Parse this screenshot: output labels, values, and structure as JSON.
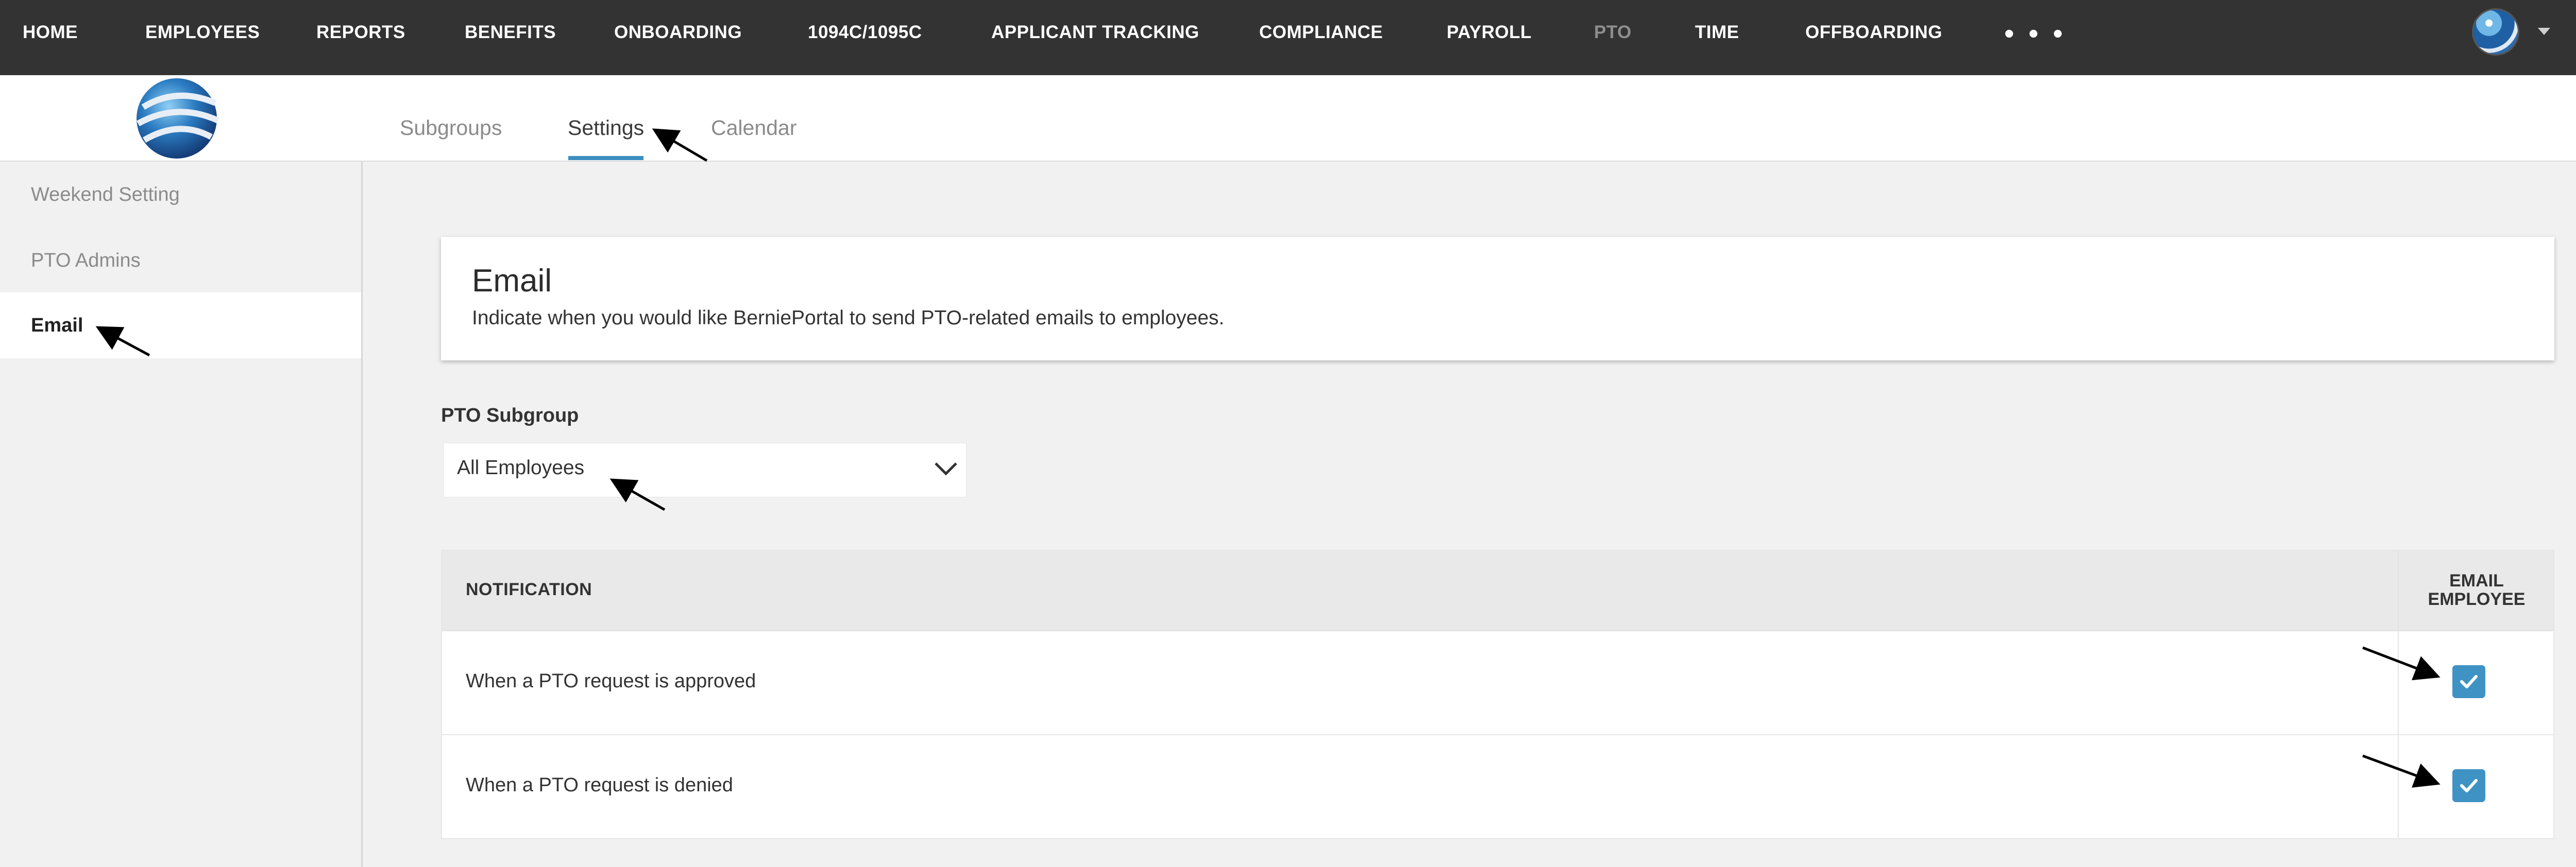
{
  "topnav": {
    "items": [
      {
        "label": "HOME",
        "active": false
      },
      {
        "label": "EMPLOYEES",
        "active": false
      },
      {
        "label": "REPORTS",
        "active": false
      },
      {
        "label": "BENEFITS",
        "active": false
      },
      {
        "label": "ONBOARDING",
        "active": false
      },
      {
        "label": "1094C/1095C",
        "active": false
      },
      {
        "label": "APPLICANT TRACKING",
        "active": false
      },
      {
        "label": "COMPLIANCE",
        "active": false
      },
      {
        "label": "PAYROLL",
        "active": false
      },
      {
        "label": "PTO",
        "active": true
      },
      {
        "label": "TIME",
        "active": false
      },
      {
        "label": "OFFBOARDING",
        "active": false
      }
    ],
    "more_label": "• • •"
  },
  "tabs": [
    {
      "label": "Subgroups",
      "active": false
    },
    {
      "label": "Settings",
      "active": true
    },
    {
      "label": "Calendar",
      "active": false
    }
  ],
  "sidebar": {
    "items": [
      {
        "label": "Weekend Setting",
        "active": false
      },
      {
        "label": "PTO Admins",
        "active": false
      },
      {
        "label": "Email",
        "active": true
      }
    ]
  },
  "card": {
    "title": "Email",
    "description": "Indicate when you would like BerniePortal to send PTO-related emails to employees."
  },
  "subgroup": {
    "label": "PTO Subgroup",
    "selected": "All Employees"
  },
  "table": {
    "columns": [
      "NOTIFICATION",
      "EMAIL EMPLOYEE"
    ],
    "email_header_lines": [
      "EMAIL",
      "EMPLOYEE"
    ],
    "rows": [
      {
        "notification": "When a PTO request is approved",
        "email_employee": true
      },
      {
        "notification": "When a PTO request is denied",
        "email_employee": true
      }
    ]
  },
  "colors": {
    "topnav_bg": "#333333",
    "accent": "#3d8ebf",
    "checkbox": "#3f93c4"
  },
  "icons": [
    "globe-logo-icon",
    "avatar-icon",
    "caret-down-icon",
    "trash-icon",
    "chevron-down-icon",
    "check-icon",
    "annotation-arrow-icon"
  ]
}
